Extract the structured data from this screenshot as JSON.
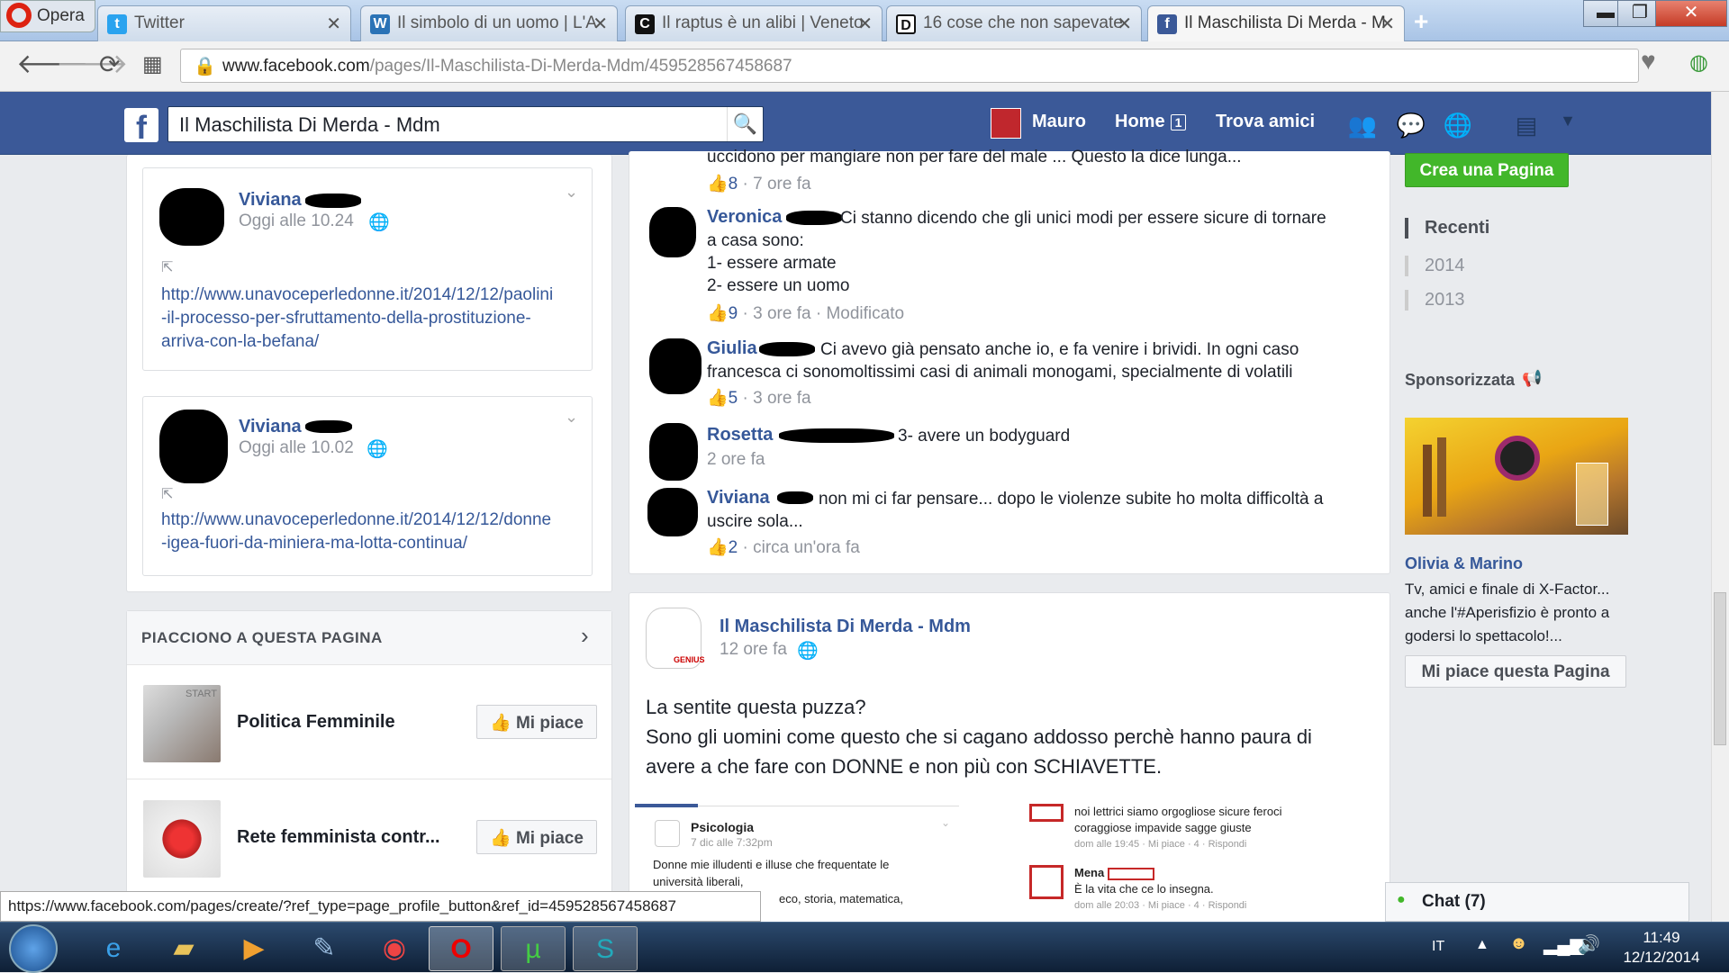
{
  "browser": {
    "opera_label": "Opera",
    "tabs": [
      {
        "label": "Twitter",
        "icon": "twitter-icon"
      },
      {
        "label": "Il simbolo di un uomo | L'A",
        "icon": "wordpress-icon"
      },
      {
        "label": "Il raptus è un alibi | Veneto",
        "icon": "c-icon"
      },
      {
        "label": "16 cose che non sapevate",
        "icon": "d-icon"
      },
      {
        "label": "Il Maschilista Di Merda - M",
        "icon": "facebook-icon"
      }
    ],
    "url_host": "www.facebook.com",
    "url_path": "/pages/Il-Maschilista-Di-Merda-Mdm/459528567458687"
  },
  "fb_header": {
    "search_value": "Il Maschilista Di Merda - Mdm",
    "user": "Mauro",
    "home": "Home",
    "home_badge": "1",
    "find_friends": "Trova amici"
  },
  "left_posts": [
    {
      "name": "Viviana",
      "time": "Oggi alle 10.24",
      "link": [
        "http://www.unavoceperledonne.it/2014/12/12/paolini",
        "-il-processo-per-sfruttamento-della-prostituzione-",
        "arriva-con-la-befana/"
      ]
    },
    {
      "name": "Viviana",
      "time": "Oggi alle 10.02",
      "link": [
        "http://www.unavoceperledonne.it/2014/12/12/donne",
        "-igea-fuori-da-miniera-ma-lotta-continua/"
      ]
    }
  ],
  "likes_box": {
    "title": "PIACCIONO A QUESTA PAGINA",
    "items": [
      {
        "name": "Politica Femminile",
        "button": "Mi piace",
        "thumb_label": "START"
      },
      {
        "name": "Rete femminista contr...",
        "button": "Mi piace"
      }
    ]
  },
  "comments": {
    "top_text": "uccidono per mangiare non per fare del male ... Questo la dice lunga...",
    "top_likes": "8",
    "top_time": "· 7 ore fa",
    "items": [
      {
        "name": "Veronica",
        "lines": [
          "Ci stanno dicendo che gli unici modi per essere sicure di tornare",
          "a casa sono:",
          "1- essere armate",
          "2- essere un uomo"
        ],
        "likes": "9",
        "time": "· 3 ore fa · Modificato"
      },
      {
        "name": "Giulia",
        "lines": [
          "Ci avevo già pensato anche io, e fa venire i brividi. In ogni caso",
          "francesca ci sonomoltissimi casi di animali monogami, specialmente di volatili"
        ],
        "likes": "5",
        "time": "· 3 ore fa"
      },
      {
        "name": "Rosetta",
        "lines": [
          "3- avere un bodyguard"
        ],
        "likes": "",
        "time": "2 ore fa"
      },
      {
        "name": "Viviana",
        "lines": [
          "non mi ci far pensare... dopo le violenze subite ho molta difficoltà a",
          "uscire sola..."
        ],
        "likes": "2",
        "time": "· circa un'ora fa"
      }
    ]
  },
  "main_post": {
    "page_name": "Il Maschilista Di Merda - Mdm",
    "time": "12 ore fa",
    "avatar_label": "GENIUS",
    "body": [
      "La sentite questa puzza?",
      "Sono gli uomini come questo che si cagano addosso perchè hanno paura di",
      "avere a che fare con DONNE e non più con SCHIAVETTE."
    ],
    "embed_left": {
      "name": "Psicologia",
      "date": "7 dic alle 7:32pm",
      "text": [
        "Donne mie illudenti e illuse che frequentate le",
        "università liberali,",
        "eco, storia, matematica,"
      ]
    },
    "embed_right": [
      {
        "name": "",
        "text": [
          "noi lettrici siamo orgogliose sicure feroci",
          "coraggiose impavide sagge giuste"
        ],
        "meta": "dom alle 19:45 · Mi piace · 4 · Rispondi"
      },
      {
        "name": "Mena",
        "text": [
          "È la vita che ce lo insegna."
        ],
        "meta": "dom alle 20:03 · Mi piace · 4 · Rispondi"
      }
    ]
  },
  "right_col": {
    "create_page": "Crea una Pagina",
    "timeline": [
      "Recenti",
      "2014",
      "2013"
    ],
    "sponsored": "Sponsorizzata",
    "ad_title": "Olivia & Marino",
    "ad_text": [
      "Tv, amici e finale di X-Factor...",
      "anche l'#Aperisfizio è pronto a",
      "godersi lo spettacolo!..."
    ],
    "ad_button": "Mi piace questa Pagina",
    "chat": "Chat (7)"
  },
  "status_url": "https://www.facebook.com/pages/create/?ref_type=page_profile_button&ref_id=459528567458687",
  "taskbar": {
    "lang": "IT",
    "time": "11:49",
    "date": "12/12/2014"
  },
  "colors": {
    "fb_blue": "#3b5998",
    "link_blue": "#365899",
    "green": "#42b72a"
  }
}
